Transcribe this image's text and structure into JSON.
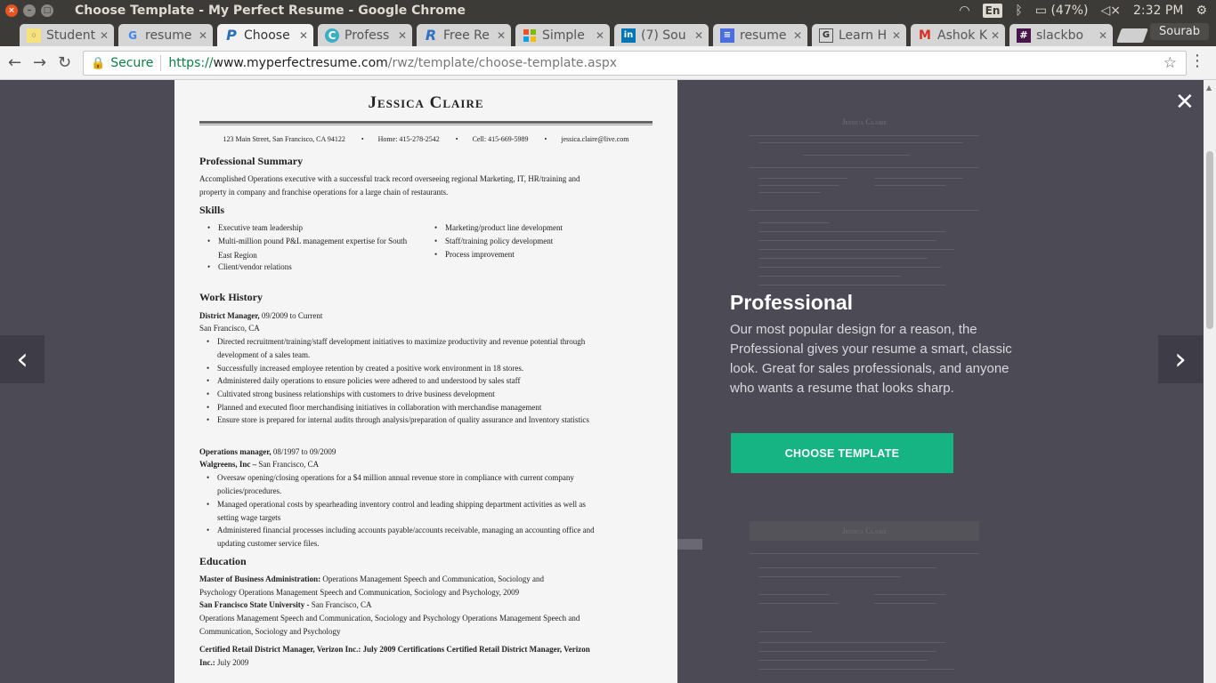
{
  "os": {
    "window_title": "Choose Template - My Perfect Resume - Google Chrome",
    "lang": "En",
    "battery": "(47%)",
    "time": "2:32 PM"
  },
  "tabs": [
    {
      "label": "Student",
      "fav": "bulb-icon"
    },
    {
      "label": "resume",
      "fav": "google-icon"
    },
    {
      "label": "Choose",
      "fav": "p-icon"
    },
    {
      "label": "Profess",
      "fav": "c-icon"
    },
    {
      "label": "Free Re",
      "fav": "r-icon"
    },
    {
      "label": "Simple",
      "fav": "microsoft-icon"
    },
    {
      "label": "(7) Sou",
      "fav": "linkedin-icon"
    },
    {
      "label": "resume",
      "fav": "docs-icon"
    },
    {
      "label": "Learn H",
      "fav": "g-icon"
    },
    {
      "label": "Ashok K",
      "fav": "gmail-icon"
    },
    {
      "label": "slackbo",
      "fav": "slack-icon"
    }
  ],
  "profile": "Sourab",
  "address": {
    "secure_label": "Secure",
    "scheme": "https://",
    "host": "www.myperfectresume.com",
    "path": "/rwz/template/choose-template.aspx"
  },
  "resume": {
    "name": "Jessica  Claire",
    "contact": [
      "123 Main Street, San Francisco, CA 94122",
      "Home: 415-278-2542",
      "Cell: 415-669-5989",
      "jessica.claire@live.com"
    ],
    "summary_heading": "Professional Summary",
    "summary_text": "Accomplished Operations executive with a successful track record overseeing regional Marketing, IT, HR/training and property in company and franchise operations for a large chain of restaurants.",
    "skills_heading": "Skills",
    "skills_left": [
      "Executive team leadership",
      "Multi-million pound P&L management expertise for South East Region",
      "Client/vendor relations"
    ],
    "skills_right": [
      "Marketing/product line development",
      "Staff/training policy development",
      "Process improvement"
    ],
    "work_heading": "Work History",
    "job1_title": "District Manager,",
    "job1_dates": " 09/2009 to Current",
    "job1_location": "San Francisco, CA",
    "job1_bullets": [
      "Directed recruitment/training/staff development initiatives to maximize productivity and revenue potential through development of a sales team.",
      "Successfully increased employee retention by created a positive work environment in 18 stores.",
      "Administered daily operations to ensure policies were adhered to and understood by sales staff",
      "Cultivated strong business relationships with customers to drive business development",
      "Planned and executed floor merchandising initiatives in collaboration with merchandise management",
      "Ensure store is prepared for internal audits through analysis/preparation of quality assurance and Inventory statistics"
    ],
    "job2_title": "Operations manager,",
    "job2_dates": " 08/1997 to 09/2009",
    "job2_company": "Walgreens, Inc – ",
    "job2_location": "San Francisco, CA",
    "job2_bullets": [
      "Oversaw opening/closing operations for a $4 million annual revenue store in compliance with current company policies/procedures.",
      "Managed operational costs by spearheading inventory control and leading shipping department activities as well as setting wage targets",
      "Administered financial processes including accounts payable/accounts receivable, managing an accounting office and updating customer service files."
    ],
    "edu_heading": "Education",
    "edu1_degree": "Master of Business Administration:",
    "edu1_text": " Operations Management Speech and Communication, Sociology and Psychology Operations Management Speech and Communication, Sociology and Psychology, 2009",
    "edu1_school": "San Francisco State University - ",
    "edu1_location": "San Francisco, CA",
    "edu1_detail": "Operations Management Speech and Communication, Sociology and Psychology Operations Management Speech and Communication, Sociology and Psychology",
    "cert_text": "Certified Retail District Manager, Verizon Inc.: July 2009 Certifications Certified Retail District Manager, Verizon Inc.:",
    "cert_date": "  July 2009"
  },
  "preview_ghost_name": "Jessica Claire",
  "template": {
    "title": "Professional",
    "description": "Our most popular design for a reason, the Professional gives your resume a smart, classic look. Great for sales professionals, and anyone who wants a resume that looks sharp.",
    "button": "CHOOSE TEMPLATE"
  },
  "colors": {
    "accent_button": "#16b483",
    "overlay": "#4b4a55"
  }
}
